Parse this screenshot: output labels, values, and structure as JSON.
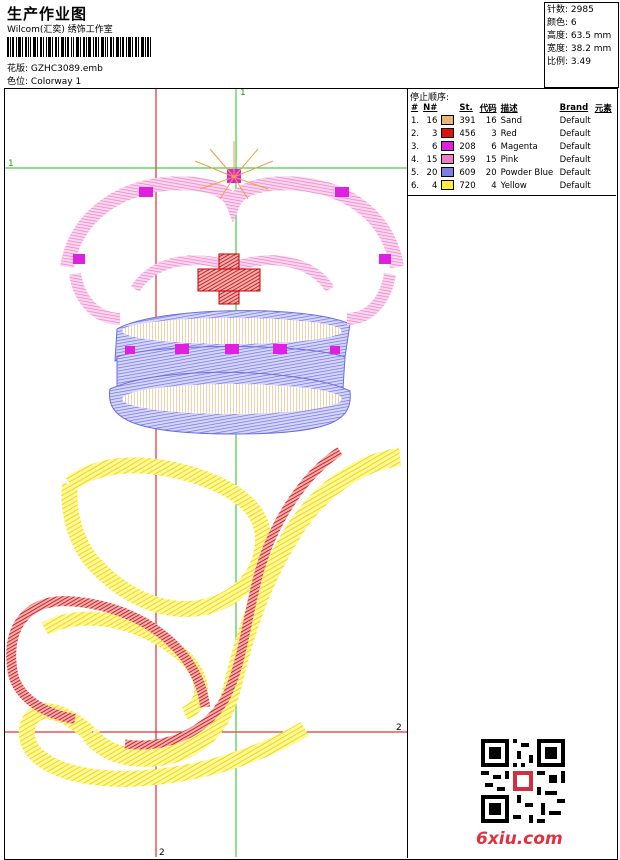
{
  "header": {
    "title": "生产作业图",
    "company": "Wilcom(汇奕) 绣饰工作室",
    "design_label": "花版:",
    "design_value": "GZHC3089.emb",
    "colorway_label": "色位:",
    "colorway_value": "Colorway 1"
  },
  "stats": {
    "stitches": "针数: 2985",
    "colors": "颜色: 6",
    "height": "高度: 63.5 mm",
    "width": "宽度: 38.2 mm",
    "scale": "比例: 3.49"
  },
  "sequence": {
    "heading": "停止顺序:",
    "columns": [
      "#",
      "N#",
      "St.",
      "代码",
      "描述",
      "Brand",
      "元素"
    ],
    "rows": [
      {
        "idx": "1.",
        "needle": "16",
        "color": "#e8b67a",
        "st": "391",
        "code": "16",
        "desc": "Sand",
        "brand": "Default"
      },
      {
        "idx": "2.",
        "needle": "3",
        "color": "#e01010",
        "st": "456",
        "code": "3",
        "desc": "Red",
        "brand": "Default"
      },
      {
        "idx": "3.",
        "needle": "6",
        "color": "#e020e0",
        "st": "208",
        "code": "6",
        "desc": "Magenta",
        "brand": "Default"
      },
      {
        "idx": "4.",
        "needle": "15",
        "color": "#f07cc8",
        "st": "599",
        "code": "15",
        "desc": "Pink",
        "brand": "Default"
      },
      {
        "idx": "5.",
        "needle": "20",
        "color": "#7b7ee6",
        "st": "609",
        "code": "20",
        "desc": "Powder Blue",
        "brand": "Default"
      },
      {
        "idx": "6.",
        "needle": "4",
        "color": "#ffef3a",
        "st": "720",
        "code": "4",
        "desc": "Yellow",
        "brand": "Default"
      }
    ]
  },
  "guides": {
    "v1": "1",
    "h1": "1",
    "h2": "2",
    "v2": "2"
  },
  "watermark": {
    "site": "6xiu.com"
  }
}
